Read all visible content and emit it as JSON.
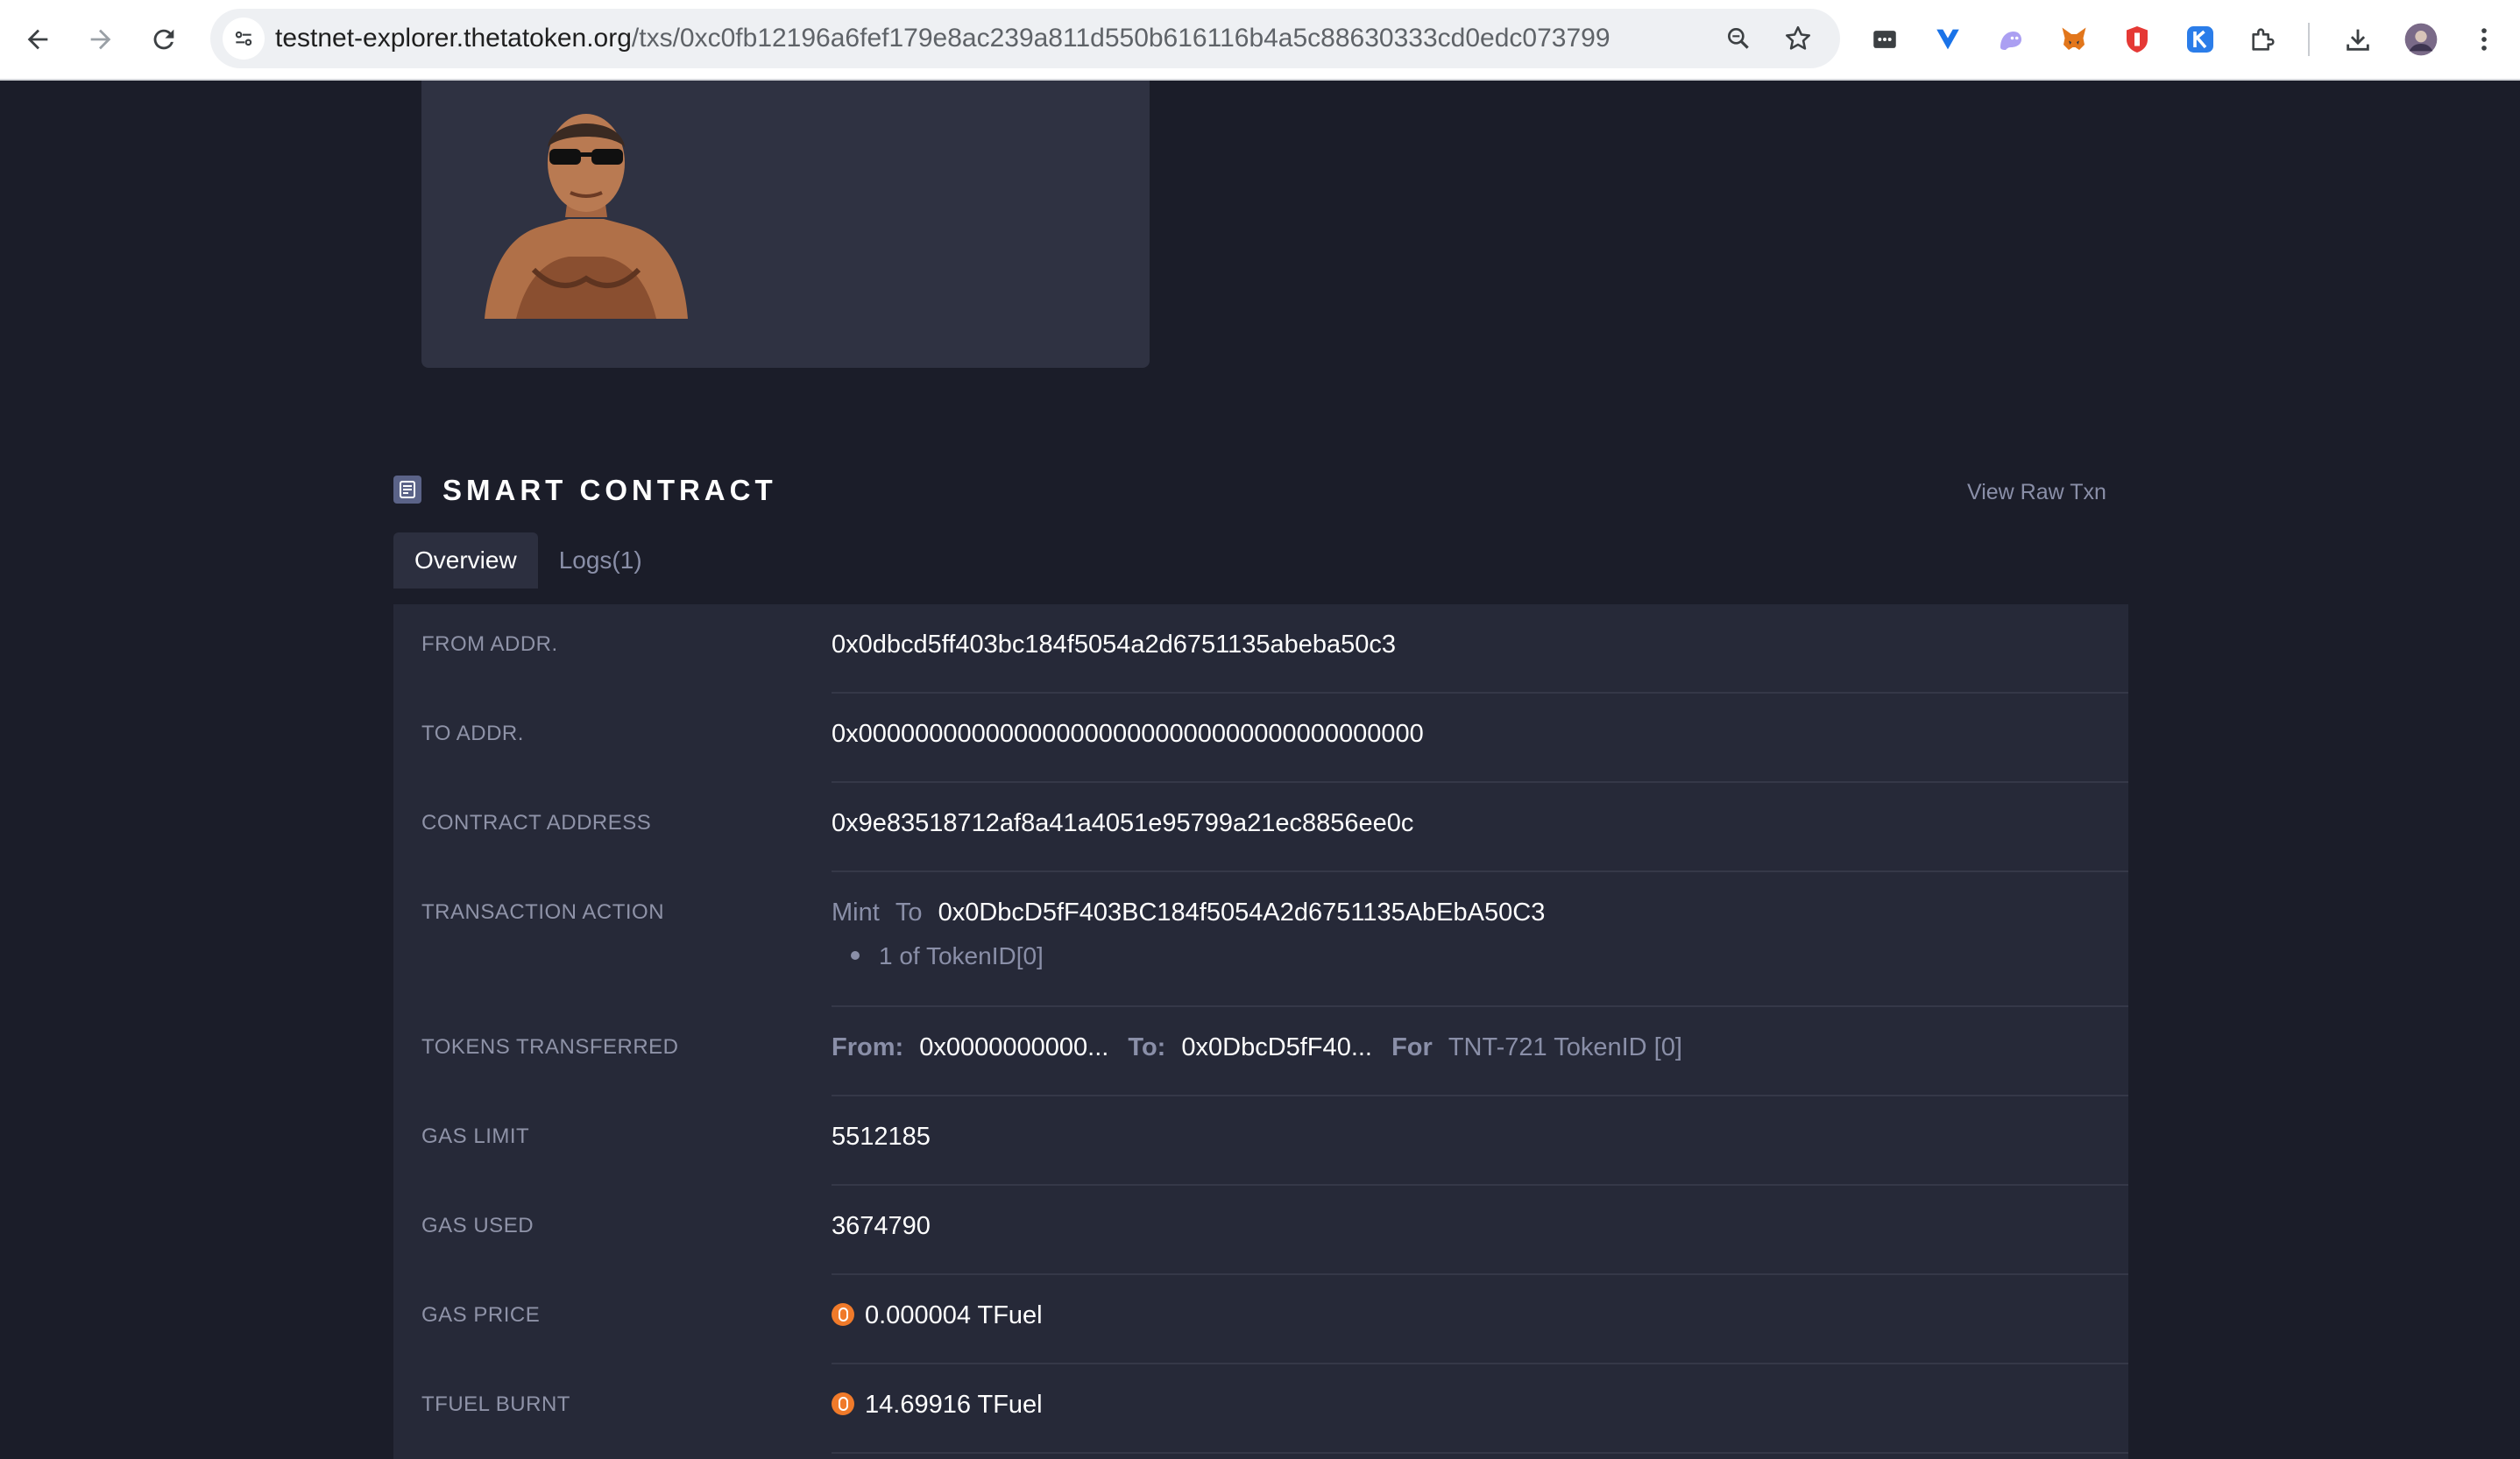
{
  "browser": {
    "url_host": "testnet-explorer.thetatoken.org",
    "url_path": "/txs/0xc0fb12196a6fef179e8ac239a811d550b616116b4a5c88630333cd0edc073799",
    "icons": [
      "back-arrow-icon",
      "forward-arrow-icon",
      "reload-icon",
      "site-info-icon",
      "zoom-icon",
      "bookmark-star-icon",
      "password-manager-icon",
      "vpn-extension-icon",
      "ghost-extension-icon",
      "metamask-fox-icon",
      "shield-extension-icon",
      "k-extension-icon",
      "puzzle-extensions-icon",
      "download-icon",
      "profile-avatar",
      "more-menu-icon"
    ]
  },
  "nft": {
    "image_alt": "muscular man wearing sunglasses"
  },
  "section": {
    "title": "SMART CONTRACT",
    "raw_link": "View Raw Txn"
  },
  "tabs": [
    {
      "label": "Overview",
      "active": true
    },
    {
      "label": "Logs(1)",
      "active": false
    }
  ],
  "details": {
    "from_addr": {
      "label": "FROM ADDR.",
      "value": "0x0dbcd5ff403bc184f5054a2d6751135abeba50c3"
    },
    "to_addr": {
      "label": "TO ADDR.",
      "value": "0x0000000000000000000000000000000000000000"
    },
    "contract_address": {
      "label": "CONTRACT ADDRESS",
      "value": "0x9e83518712af8a41a4051e95799a21ec8856ee0c"
    },
    "transaction_action": {
      "label": "TRANSACTION ACTION",
      "action": "Mint",
      "to_word": "To",
      "to_address": "0x0DbcD5fF403BC184f5054A2d6751135AbEbA50C3",
      "item": "1 of TokenID[0]"
    },
    "tokens_transferred": {
      "label": "TOKENS TRANSFERRED",
      "from_label": "From:",
      "from_value": "0x0000000000...",
      "to_label": "To:",
      "to_value": "0x0DbcD5fF40...",
      "for_label": "For",
      "for_value": "TNT-721 TokenID [0]"
    },
    "gas_limit": {
      "label": "GAS LIMIT",
      "value": "5512185"
    },
    "gas_used": {
      "label": "GAS USED",
      "value": "3674790"
    },
    "gas_price": {
      "label": "GAS PRICE",
      "value": "0.000004 TFuel",
      "icon": "tfuel-coin-icon"
    },
    "tfuel_burnt": {
      "label": "TFUEL BURNT",
      "value": "14.69916 TFuel",
      "icon": "tfuel-coin-icon"
    }
  }
}
